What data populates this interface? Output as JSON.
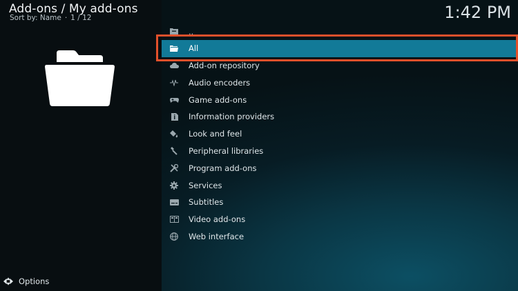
{
  "header": {
    "title": "Add-ons / My add-ons",
    "sort_label": "Sort by: Name",
    "separator": "·",
    "position": "1 / 12",
    "clock": "1:42 PM"
  },
  "list": {
    "parent_label": "..",
    "items": [
      {
        "label": "All",
        "icon": "folder-icon",
        "selected": true
      },
      {
        "label": "Add-on repository",
        "icon": "cloud-icon"
      },
      {
        "label": "Audio encoders",
        "icon": "waveform-icon"
      },
      {
        "label": "Game add-ons",
        "icon": "gamepad-icon"
      },
      {
        "label": "Information providers",
        "icon": "info-icon"
      },
      {
        "label": "Look and feel",
        "icon": "paint-bucket-icon"
      },
      {
        "label": "Peripheral libraries",
        "icon": "usb-icon"
      },
      {
        "label": "Program add-ons",
        "icon": "tools-icon"
      },
      {
        "label": "Services",
        "icon": "gear-icon"
      },
      {
        "label": "Subtitles",
        "icon": "subtitles-icon"
      },
      {
        "label": "Video add-ons",
        "icon": "film-icon"
      },
      {
        "label": "Web interface",
        "icon": "globe-icon"
      }
    ]
  },
  "footer": {
    "options_label": "Options",
    "icon": "options-arrows-icon"
  },
  "colors": {
    "selection": "#127a98",
    "highlight_border": "#e2502b",
    "background": "#050b0e"
  }
}
